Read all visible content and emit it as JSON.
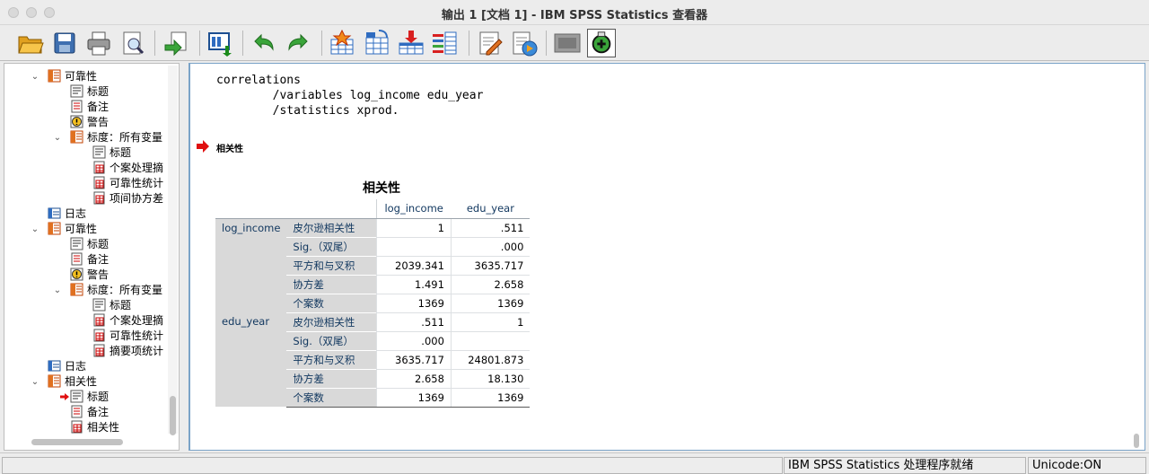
{
  "window": {
    "title": "输出 1 [文档 1] - IBM SPSS Statistics 查看器"
  },
  "toolbar": {
    "buttons": [
      "open-icon",
      "save-icon",
      "print-icon",
      "print-preview-icon",
      "export-icon",
      "recall-dialog-icon",
      "undo-icon",
      "redo-icon",
      "goto-data-icon",
      "goto-case-icon",
      "goto-variable-icon",
      "variables-icon",
      "insert-output-icon",
      "run-script-icon",
      "designate-window-icon",
      "add-item-icon"
    ]
  },
  "outline": {
    "items": [
      {
        "text": "可靠性",
        "icon": "procedure-icon",
        "expander": "⌄"
      },
      {
        "text": "标题",
        "icon": "title-icon"
      },
      {
        "text": "备注",
        "icon": "notes-icon"
      },
      {
        "text": "警告",
        "icon": "warning-icon"
      },
      {
        "text": "标度：所有变量",
        "icon": "procedure-icon",
        "expander": "⌄"
      },
      {
        "text": "标题",
        "icon": "title-icon"
      },
      {
        "text": "个案处理摘",
        "icon": "table-icon"
      },
      {
        "text": "可靠性统计",
        "icon": "table-icon"
      },
      {
        "text": "项间协方差",
        "icon": "table-icon"
      },
      {
        "text": "日志",
        "icon": "log-icon"
      },
      {
        "text": "可靠性",
        "icon": "procedure-icon",
        "expander": "⌄"
      },
      {
        "text": "标题",
        "icon": "title-icon"
      },
      {
        "text": "备注",
        "icon": "notes-icon"
      },
      {
        "text": "警告",
        "icon": "warning-icon"
      },
      {
        "text": "标度：所有变量",
        "icon": "procedure-icon",
        "expander": "⌄"
      },
      {
        "text": "标题",
        "icon": "title-icon"
      },
      {
        "text": "个案处理摘",
        "icon": "table-icon"
      },
      {
        "text": "可靠性统计",
        "icon": "table-icon"
      },
      {
        "text": "摘要项统计",
        "icon": "table-icon"
      },
      {
        "text": "日志",
        "icon": "log-icon"
      },
      {
        "text": "相关性",
        "icon": "procedure-icon",
        "expander": "⌄"
      },
      {
        "text": "标题",
        "icon": "title-icon",
        "current": true
      },
      {
        "text": "备注",
        "icon": "notes-icon"
      },
      {
        "text": "相关性",
        "icon": "table-icon"
      }
    ]
  },
  "content": {
    "syntax": "correlations\n        /variables log_income edu_year\n        /statistics xprod.",
    "section_heading": "相关性",
    "table": {
      "title": "相关性",
      "columns": [
        "log_income",
        "edu_year"
      ],
      "groups": [
        {
          "name": "log_income",
          "rows": [
            {
              "stat": "皮尔逊相关性",
              "values": [
                "1",
                ".511"
              ]
            },
            {
              "stat": "Sig.（双尾）",
              "values": [
                "",
                ".000"
              ]
            },
            {
              "stat": "平方和与叉积",
              "values": [
                "2039.341",
                "3635.717"
              ]
            },
            {
              "stat": "协方差",
              "values": [
                "1.491",
                "2.658"
              ]
            },
            {
              "stat": "个案数",
              "values": [
                "1369",
                "1369"
              ]
            }
          ]
        },
        {
          "name": "edu_year",
          "rows": [
            {
              "stat": "皮尔逊相关性",
              "values": [
                ".511",
                "1"
              ]
            },
            {
              "stat": "Sig.（双尾）",
              "values": [
                ".000",
                ""
              ]
            },
            {
              "stat": "平方和与叉积",
              "values": [
                "3635.717",
                "24801.873"
              ]
            },
            {
              "stat": "协方差",
              "values": [
                "2.658",
                "18.130"
              ]
            },
            {
              "stat": "个案数",
              "values": [
                "1369",
                "1369"
              ]
            }
          ]
        }
      ]
    }
  },
  "status": {
    "processor": "IBM SPSS Statistics 处理程序就绪",
    "unicode": "Unicode:ON"
  }
}
